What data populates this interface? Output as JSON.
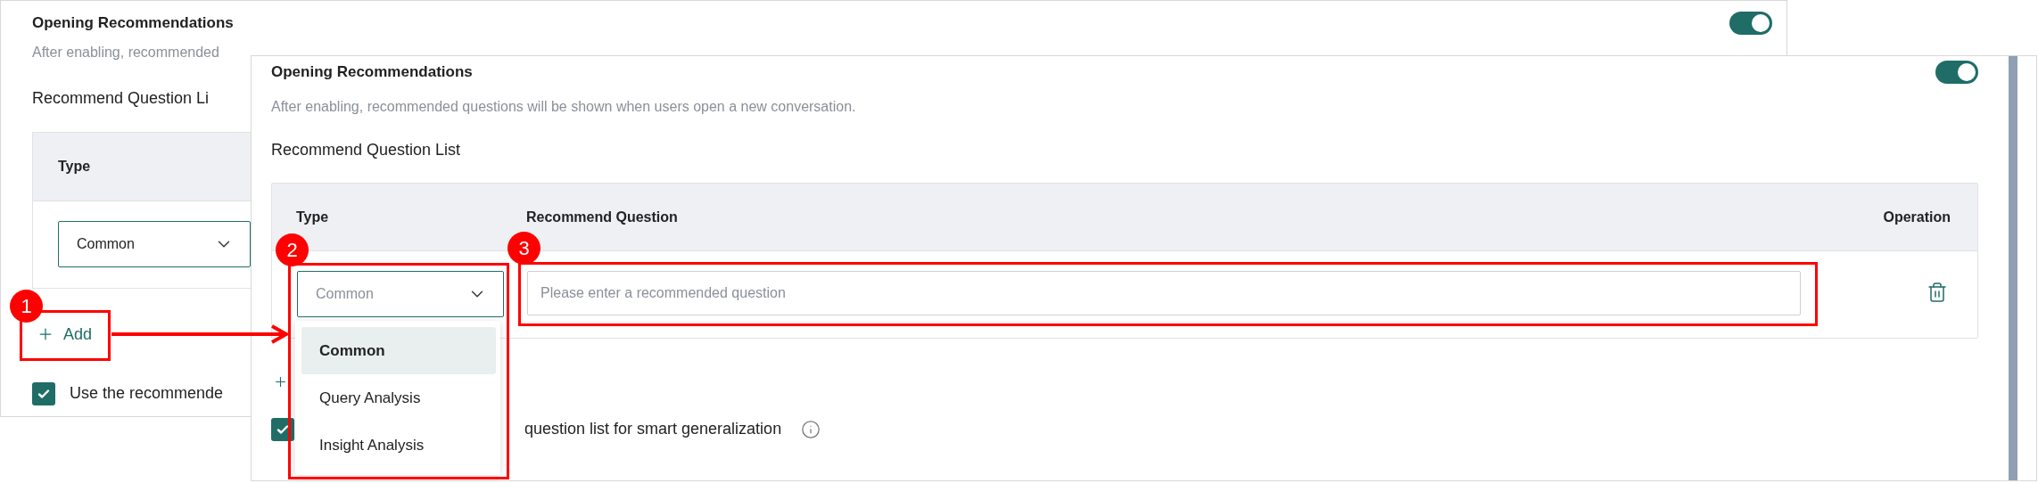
{
  "back_panel": {
    "title": "Opening Recommendations",
    "description": "After enabling, recommended",
    "toggle": {
      "on": true
    },
    "list_label": "Recommend Question Li",
    "table": {
      "columns": [
        "Type"
      ],
      "rows": [
        {
          "type": "Common"
        }
      ]
    },
    "add_button": "Add",
    "checkbox": {
      "label": "Use the recommende",
      "checked": true
    }
  },
  "front_panel": {
    "title": "Opening Recommendations",
    "description": "After enabling, recommended questions will be shown when users open a new conversation.",
    "toggle": {
      "on": true
    },
    "list_label": "Recommend Question List",
    "table": {
      "columns": [
        "Type",
        "Recommend Question",
        "Operation"
      ],
      "rows": [
        {
          "type": "Common",
          "question_placeholder": "Please enter a recommended question"
        }
      ]
    },
    "checkbox": {
      "label": "question list for smart generalization",
      "checked": true
    },
    "dropdown": {
      "options": [
        {
          "label": "Common",
          "selected": true
        },
        {
          "label": "Query Analysis",
          "selected": false
        },
        {
          "label": "Insight Analysis",
          "selected": false
        }
      ]
    }
  },
  "annotations": [
    {
      "number": "1"
    },
    {
      "number": "2"
    },
    {
      "number": "3"
    }
  ]
}
